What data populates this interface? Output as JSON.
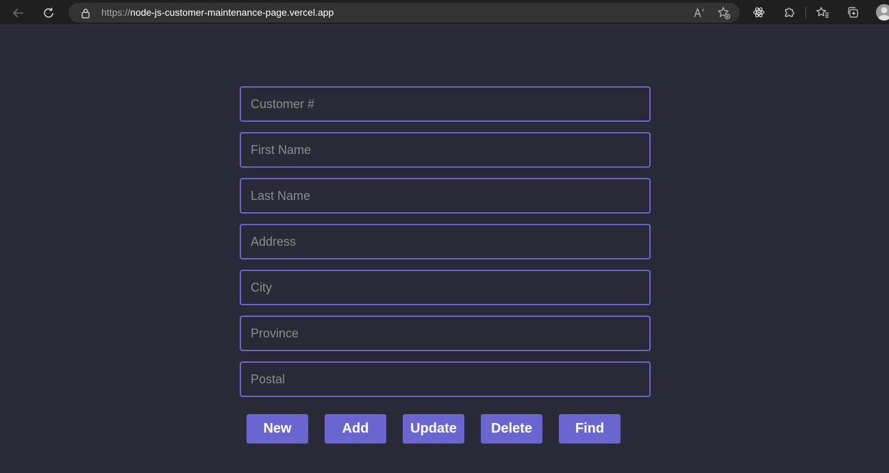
{
  "browser": {
    "url_scheme": "https://",
    "url_host": "node-js-customer-maintenance-page.vercel.app",
    "icons": {
      "back": "back-arrow-icon",
      "refresh": "refresh-icon",
      "lock": "lock-icon",
      "read_aloud": "read-aloud-icon",
      "favorite": "add-favorite-icon",
      "react_devtools": "react-atom-icon",
      "extensions": "puzzle-extensions-icon",
      "favorites": "favorites-star-icon",
      "collections": "collections-icon",
      "profile": "profile-avatar-icon"
    }
  },
  "form": {
    "fields": [
      {
        "placeholder": "Customer #",
        "value": ""
      },
      {
        "placeholder": "First Name",
        "value": ""
      },
      {
        "placeholder": "Last Name",
        "value": ""
      },
      {
        "placeholder": "Address",
        "value": ""
      },
      {
        "placeholder": "City",
        "value": ""
      },
      {
        "placeholder": "Province",
        "value": ""
      },
      {
        "placeholder": "Postal",
        "value": ""
      }
    ]
  },
  "actions": {
    "new_label": "New",
    "add_label": "Add",
    "update_label": "Update",
    "delete_label": "Delete",
    "find_label": "Find"
  },
  "colors": {
    "page_background": "#292938",
    "accent": "#6b66cf",
    "placeholder": "#8c8c8c",
    "button_text": "#ffffff"
  }
}
